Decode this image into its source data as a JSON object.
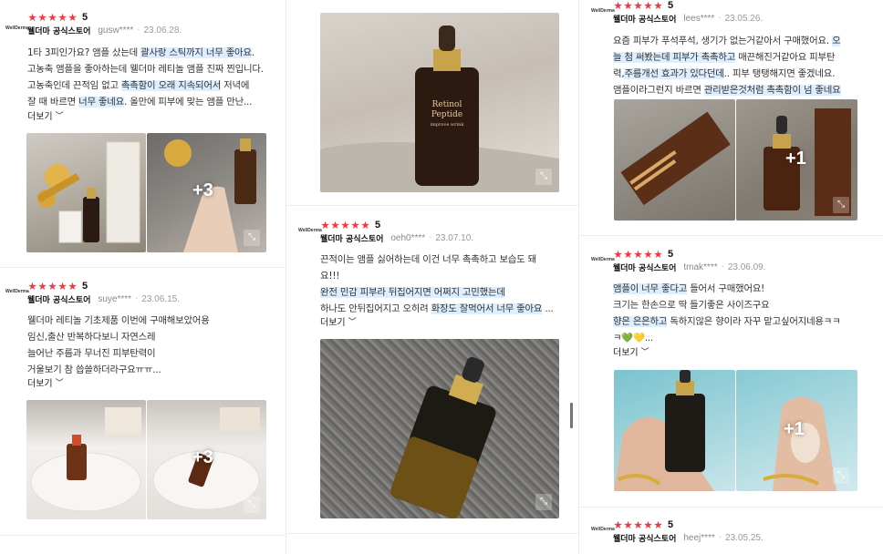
{
  "score_label": "5",
  "more_label": "더보기",
  "plus_icon": "plus-count",
  "expand_icon": "expand-icon",
  "brand_logo_text": "WellDerma",
  "bottle_text": {
    "line1": "Retinol",
    "line2": "Peptide",
    "line3": "improve wrink"
  },
  "reviews": [
    {
      "store": "웰더마 공식스토어",
      "user": "gusw****",
      "date": "23.06.28.",
      "text_lines": [
        {
          "pre": "1타 3피인가요? 앰플 샀는데 ",
          "hl": "괄사랑 스틱까지 너무 좋아요",
          "post": "."
        },
        {
          "pre": "고농축 앰플을 좋아하는데 웰더마 레티놀 앰플 진짜 찐입니다.",
          "hl": "",
          "post": ""
        },
        {
          "pre": "고농축인데 끈적임 없고 ",
          "hl": "촉촉함이 오래 지속되어서",
          "post": " 저녁에"
        },
        {
          "pre": "잘  때 바르면 ",
          "hl": "너무 좋네요",
          "post": ". 올만에 피부에 맞는 앰플 만난..."
        }
      ],
      "more_count": "+3"
    },
    {
      "store": "웰더마 공식스토어",
      "user": "suye****",
      "date": "23.06.15.",
      "text_lines": [
        {
          "pre": "웰더마 레티놀 기초제품 이번에 구매해보았어용",
          "hl": "",
          "post": ""
        },
        {
          "pre": "임신,출산 반복하다보니 자연스레",
          "hl": "",
          "post": ""
        },
        {
          "pre": "늘어난 주름과 무너진 피부탄력이",
          "hl": "",
          "post": ""
        },
        {
          "pre": "거울보기 참 씁쓸하더라구요ㅠㅠ...",
          "hl": "",
          "post": ""
        }
      ],
      "more_count": "+3"
    },
    {
      "store": "웰더마 공식스토어",
      "user": "oeh0****",
      "date": "23.07.10.",
      "text_lines": [
        {
          "pre": "끈적이는 앰플 싫어하는데 이건 너무 촉촉하고 보습도 돼",
          "hl": "",
          "post": ""
        },
        {
          "pre": "요!!!",
          "hl": "",
          "post": ""
        },
        {
          "pre": "",
          "hl": "완전 민감 피부라 뒤집어지면 어쩌지 고민했는데",
          "post": ""
        },
        {
          "pre": "하나도 안뒤집어지고 오히려 ",
          "hl": "화장도 잘먹어서 너무 좋아요",
          "post": " ..."
        }
      ]
    },
    {
      "store": "웰더마 공식스토어",
      "user": "lees****",
      "date": "23.05.26.",
      "text_lines": [
        {
          "pre": "요즘 피부가 푸석푸석, 생기가 없는거같아서 구매했어요. ",
          "hl": "오",
          "post": ""
        },
        {
          "pre": "",
          "hl": "늘 첨 써봤는데 피부가 촉촉하고",
          "post": " 매끈해진거같아요  피부탄"
        },
        {
          "pre": "력,",
          "hl": "주름개선 효과가 있다던데",
          "post": "..  피부 탱탱해지면 좋겠네요."
        },
        {
          "pre": "앰플이라그런지 바르면 ",
          "hl": "관리받은것처럼 촉촉함이 넘 좋네요",
          "post": ""
        }
      ],
      "more_count": "+1"
    },
    {
      "store": "웰더마 공식스토어",
      "user": "tmak****",
      "date": "23.06.09.",
      "text_lines": [
        {
          "pre": "",
          "hl": "앰플이 너무 좋다고",
          "post": " 들어서 구매했어요!"
        },
        {
          "pre": "크기는 한손으로 딱 들기좋은 사이즈구요",
          "hl": "",
          "post": ""
        },
        {
          "pre": "",
          "hl": "향은 은은하고",
          "post": " 독하지않은 향이라 자꾸 맡고싶어지네용ㅋㅋ"
        },
        {
          "pre": "ㅋ💚💛...",
          "hl": "",
          "post": ""
        }
      ],
      "more_count": "+1"
    },
    {
      "store": "웰더마 공식스토어",
      "user": "heej****",
      "date": "23.05.25."
    }
  ]
}
